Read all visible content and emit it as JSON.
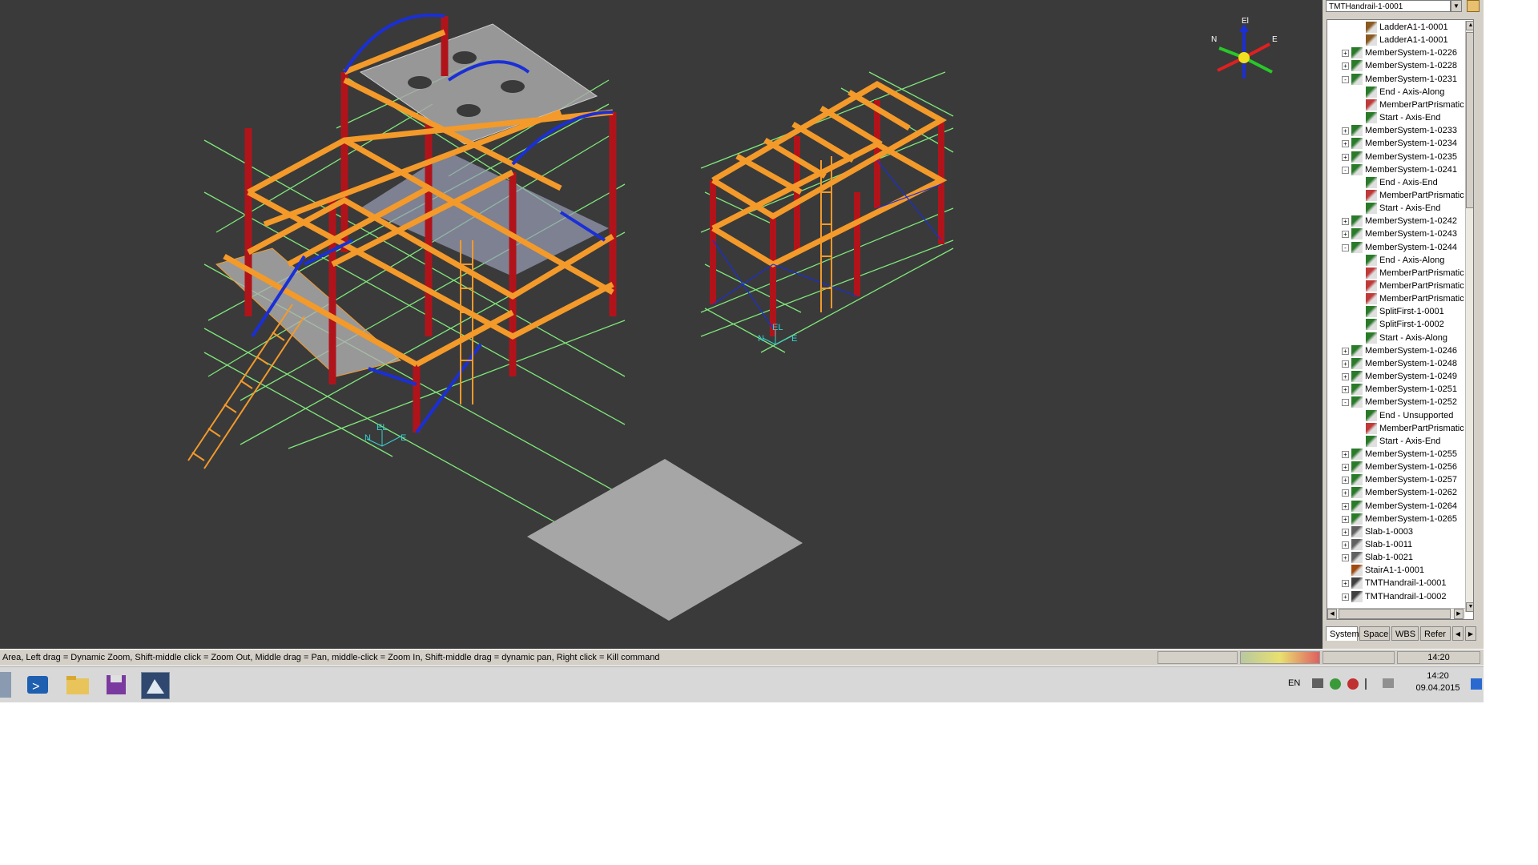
{
  "window": {
    "selection_combo": "TMTHandrail-1-0001"
  },
  "viewport": {
    "compass": {
      "up": "El",
      "north": "N",
      "east": "E"
    },
    "struct_a_axis": {
      "el": "EL",
      "n": "N",
      "e": "E"
    },
    "struct_b_axis": {
      "el": "EL",
      "n": "N",
      "e": "E"
    },
    "colors": {
      "background": "#3a3a3a",
      "grid": "#7fe87a",
      "beam": "#f39a2a",
      "column": "#b0141a",
      "brace": "#1a2fd6",
      "slab": "#b8b8b8"
    }
  },
  "tree": {
    "items": [
      {
        "label": "LadderA1-1-0001",
        "level": 1,
        "expander": "",
        "icon": "ladder-icon"
      },
      {
        "label": "LadderA1-1-0001",
        "level": 1,
        "expander": "",
        "icon": "ladder-icon"
      },
      {
        "label": "MemberSystem-1-0226",
        "level": 0,
        "expander": "+",
        "icon": "member-system-icon"
      },
      {
        "label": "MemberSystem-1-0228",
        "level": 0,
        "expander": "+",
        "icon": "member-system-icon"
      },
      {
        "label": "MemberSystem-1-0231",
        "level": 0,
        "expander": "-",
        "icon": "member-system-icon"
      },
      {
        "label": "End - Axis-Along",
        "level": 1,
        "expander": "",
        "icon": "frame-connection-icon"
      },
      {
        "label": "MemberPartPrismatic",
        "level": 1,
        "expander": "",
        "icon": "member-part-icon"
      },
      {
        "label": "Start - Axis-End",
        "level": 1,
        "expander": "",
        "icon": "frame-connection-icon"
      },
      {
        "label": "MemberSystem-1-0233",
        "level": 0,
        "expander": "+",
        "icon": "member-system-icon"
      },
      {
        "label": "MemberSystem-1-0234",
        "level": 0,
        "expander": "+",
        "icon": "member-system-icon"
      },
      {
        "label": "MemberSystem-1-0235",
        "level": 0,
        "expander": "+",
        "icon": "member-system-icon"
      },
      {
        "label": "MemberSystem-1-0241",
        "level": 0,
        "expander": "-",
        "icon": "member-system-icon"
      },
      {
        "label": "End - Axis-End",
        "level": 1,
        "expander": "",
        "icon": "frame-connection-icon"
      },
      {
        "label": "MemberPartPrismatic",
        "level": 1,
        "expander": "",
        "icon": "member-part-icon"
      },
      {
        "label": "Start - Axis-End",
        "level": 1,
        "expander": "",
        "icon": "frame-connection-icon"
      },
      {
        "label": "MemberSystem-1-0242",
        "level": 0,
        "expander": "+",
        "icon": "member-system-icon"
      },
      {
        "label": "MemberSystem-1-0243",
        "level": 0,
        "expander": "+",
        "icon": "member-system-icon"
      },
      {
        "label": "MemberSystem-1-0244",
        "level": 0,
        "expander": "-",
        "icon": "member-system-icon"
      },
      {
        "label": "End - Axis-Along",
        "level": 1,
        "expander": "",
        "icon": "frame-connection-icon"
      },
      {
        "label": "MemberPartPrismatic",
        "level": 1,
        "expander": "",
        "icon": "member-part-icon"
      },
      {
        "label": "MemberPartPrismatic",
        "level": 1,
        "expander": "",
        "icon": "member-part-icon"
      },
      {
        "label": "MemberPartPrismatic",
        "level": 1,
        "expander": "",
        "icon": "member-part-icon"
      },
      {
        "label": "SplitFirst-1-0001",
        "level": 1,
        "expander": "",
        "icon": "frame-connection-icon"
      },
      {
        "label": "SplitFirst-1-0002",
        "level": 1,
        "expander": "",
        "icon": "frame-connection-icon"
      },
      {
        "label": "Start - Axis-Along",
        "level": 1,
        "expander": "",
        "icon": "frame-connection-icon"
      },
      {
        "label": "MemberSystem-1-0246",
        "level": 0,
        "expander": "+",
        "icon": "member-system-icon"
      },
      {
        "label": "MemberSystem-1-0248",
        "level": 0,
        "expander": "+",
        "icon": "member-system-icon"
      },
      {
        "label": "MemberSystem-1-0249",
        "level": 0,
        "expander": "+",
        "icon": "member-system-icon"
      },
      {
        "label": "MemberSystem-1-0251",
        "level": 0,
        "expander": "+",
        "icon": "member-system-icon"
      },
      {
        "label": "MemberSystem-1-0252",
        "level": 0,
        "expander": "-",
        "icon": "member-system-icon"
      },
      {
        "label": "End - Unsupported",
        "level": 1,
        "expander": "",
        "icon": "frame-connection-icon"
      },
      {
        "label": "MemberPartPrismatic",
        "level": 1,
        "expander": "",
        "icon": "member-part-icon"
      },
      {
        "label": "Start - Axis-End",
        "level": 1,
        "expander": "",
        "icon": "frame-connection-icon"
      },
      {
        "label": "MemberSystem-1-0255",
        "level": 0,
        "expander": "+",
        "icon": "member-system-icon"
      },
      {
        "label": "MemberSystem-1-0256",
        "level": 0,
        "expander": "+",
        "icon": "member-system-icon"
      },
      {
        "label": "MemberSystem-1-0257",
        "level": 0,
        "expander": "+",
        "icon": "member-system-icon"
      },
      {
        "label": "MemberSystem-1-0262",
        "level": 0,
        "expander": "+",
        "icon": "member-system-icon"
      },
      {
        "label": "MemberSystem-1-0264",
        "level": 0,
        "expander": "+",
        "icon": "member-system-icon"
      },
      {
        "label": "MemberSystem-1-0265",
        "level": 0,
        "expander": "+",
        "icon": "member-system-icon"
      },
      {
        "label": "Slab-1-0003",
        "level": 0,
        "expander": "+",
        "icon": "slab-icon"
      },
      {
        "label": "Slab-1-0011",
        "level": 0,
        "expander": "+",
        "icon": "slab-icon"
      },
      {
        "label": "Slab-1-0021",
        "level": 0,
        "expander": "+",
        "icon": "slab-icon"
      },
      {
        "label": "StairA1-1-0001",
        "level": 0,
        "expander": "",
        "icon": "stair-icon"
      },
      {
        "label": "TMTHandrail-1-0001",
        "level": 0,
        "expander": "+",
        "icon": "handrail-icon"
      },
      {
        "label": "TMTHandrail-1-0002",
        "level": 0,
        "expander": "+",
        "icon": "handrail-icon"
      }
    ]
  },
  "tabs": [
    {
      "label": "System",
      "active": true
    },
    {
      "label": "Space",
      "active": false
    },
    {
      "label": "WBS",
      "active": false
    },
    {
      "label": "Refer",
      "active": false
    }
  ],
  "statusbar": {
    "hint": "Area, Left drag = Dynamic Zoom, Shift-middle click = Zoom Out, Middle drag = Pan, middle-click = Zoom In, Shift-middle drag = dynamic pan, Right click = Kill command",
    "time": "14:20"
  },
  "taskbar": {
    "language": "EN",
    "clock_time": "14:20",
    "clock_date": "09.04.2015",
    "apps": [
      "powershell-icon",
      "file-explorer-icon",
      "save-disk-icon",
      "smart3d-app-icon"
    ]
  }
}
